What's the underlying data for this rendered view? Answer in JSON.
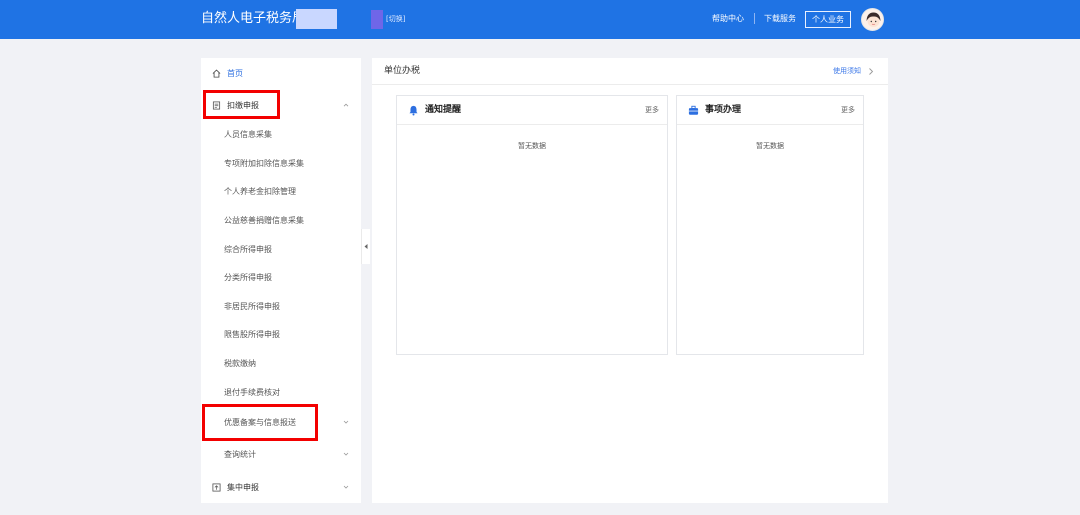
{
  "header": {
    "app_title": "自然人电子税务局",
    "switch_label": "[切换]",
    "help_center": "帮助中心",
    "download_service": "下载服务",
    "personal_business": "个人业务",
    "brand_color": "#1f73e4"
  },
  "sidebar": {
    "home": "首页",
    "withholding": {
      "label": "扣缴申报",
      "items": [
        "人员信息采集",
        "专项附加扣除信息采集",
        "个人养老金扣除管理",
        "公益慈善捐赠信息采集",
        "综合所得申报",
        "分类所得申报",
        "非居民所得申报",
        "限售股所得申报",
        "税款缴纳",
        "退付手续费核对"
      ]
    },
    "preferential": "优惠备案与信息报送",
    "query_stats": "查询统计",
    "centralized": "集中申报",
    "highlight_color": "#f30000"
  },
  "main": {
    "title": "单位办税",
    "notice_link": "使用须知",
    "panels": [
      {
        "title": "通知提醒",
        "more": "更多",
        "empty": "暂无数据",
        "icon": "bell-icon"
      },
      {
        "title": "事项办理",
        "more": "更多",
        "empty": "暂无数据",
        "icon": "briefcase-icon"
      }
    ]
  }
}
